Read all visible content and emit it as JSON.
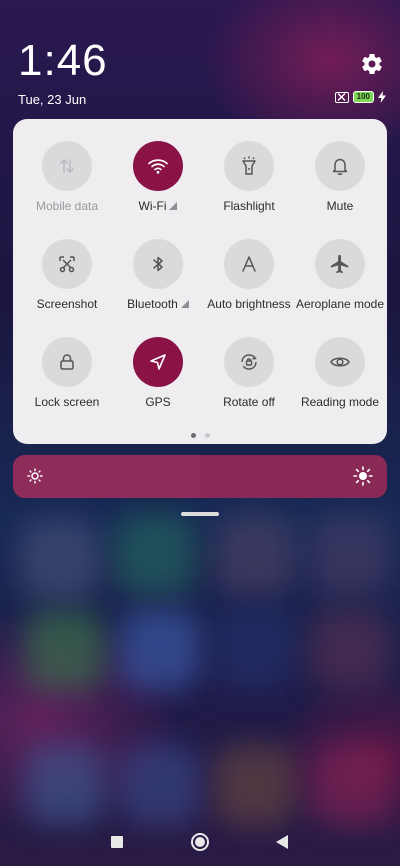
{
  "status": {
    "time": "1:46",
    "date": "Tue, 23 Jun",
    "battery_level": "100"
  },
  "quick_settings": {
    "tiles": [
      {
        "label": "Mobile data",
        "icon": "mobile-data-icon",
        "state": "disabled"
      },
      {
        "label": "Wi-Fi",
        "icon": "wifi-icon",
        "state": "on"
      },
      {
        "label": "Flashlight",
        "icon": "flashlight-icon",
        "state": "off"
      },
      {
        "label": "Mute",
        "icon": "bell-icon",
        "state": "off"
      },
      {
        "label": "Screenshot",
        "icon": "scissors-icon",
        "state": "off"
      },
      {
        "label": "Bluetooth",
        "icon": "bluetooth-icon",
        "state": "off"
      },
      {
        "label": "Auto brightness",
        "icon": "auto-brightness-icon",
        "state": "off"
      },
      {
        "label": "Aeroplane mode",
        "icon": "airplane-icon",
        "state": "off"
      },
      {
        "label": "Lock screen",
        "icon": "lock-icon",
        "state": "off"
      },
      {
        "label": "GPS",
        "icon": "location-arrow-icon",
        "state": "on"
      },
      {
        "label": "Rotate off",
        "icon": "rotate-lock-icon",
        "state": "off"
      },
      {
        "label": "Reading mode",
        "icon": "eye-icon",
        "state": "off"
      }
    ],
    "page_count": 2,
    "current_page": 1
  },
  "brightness": {
    "level": 0.5
  },
  "colors": {
    "accent": "#8a1244",
    "panel": "#efedf0",
    "tile_off": "#dcd9dd",
    "brightness_bar": "#892a56"
  }
}
